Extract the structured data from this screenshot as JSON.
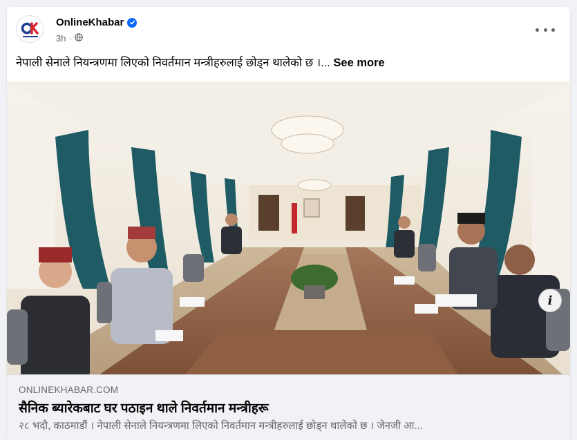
{
  "post": {
    "page_name": "OnlineKhabar",
    "time": "3h",
    "audience_icon": "globe-icon",
    "text": "नेपाली सेनाले नियन्त्रणमा लिएको निवर्तमान मन्त्रीहरुलाई छोड्न थालेको छ ।...",
    "see_more": "See more"
  },
  "link": {
    "domain": "ONLINEKHABAR.COM",
    "title": "सैनिक ब्यारेकबाट घर पठाइन थाले निवर्तमान मन्त्रीहरू",
    "description": "२८ भदौ, काठमाडौं । नेपाली सेनाले नियन्त्रणमा लिएको निवर्तमान मन्त्रीहरुलाई छोड्न थालेको छ । जेनजी आ...",
    "info_label": "i"
  },
  "colors": {
    "brand_red": "#d7262c",
    "brand_blue": "#1e3f8f",
    "verified_blue": "#0866ff"
  }
}
